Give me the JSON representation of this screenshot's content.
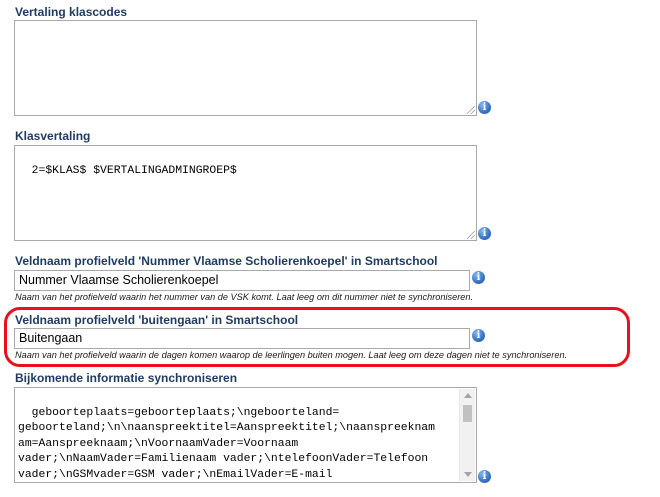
{
  "fields": {
    "vertaling_klascodes": {
      "label": "Vertaling klascodes",
      "value": ""
    },
    "klasvertaling": {
      "label": "Klasvertaling",
      "value": "2=$KLAS$ $VERTALINGADMINGROEP$"
    },
    "vsk_veld": {
      "label": "Veldnaam profielveld 'Nummer Vlaamse Scholierenkoepel' in Smartschool",
      "value": "Nummer Vlaamse Scholierenkoepel",
      "help": "Naam van het profielveld waarin het nummer van de VSK komt. Laat leeg om dit nummer niet te synchroniseren."
    },
    "buitengaan_veld": {
      "label": "Veldnaam profielveld 'buitengaan' in Smartschool",
      "value": "Buitengaan",
      "help": "Naam van het profielveld waarin de dagen komen waarop de leerlingen buiten mogen. Laat leeg om deze dagen niet te synchroniseren."
    },
    "bijkomende_info": {
      "label": "Bijkomende informatie synchroniseren",
      "value": "geboorteplaats=geboorteplaats;\\ngeboorteland=\ngeboorteland;\\n\\naanspreektitel=Aanspreektitel;\\naanspreeknam\nam=Aanspreeknaam;\\nVoornaamVader=Voornaam\nvader;\\nNaamVader=Familienaam vader;\\ntelefoonVader=Telefoon\nvader;\\nGSMvader=GSM vader;\\nEmailVader=E-mail\nvader;\\ntelefoonWerkVader=Telefoon werk"
    }
  },
  "info_icon": {
    "name": "info-icon",
    "glyph": "i"
  },
  "colors": {
    "label": "#1f3a5f",
    "highlight": "#e8101e",
    "info": "#3a78c8"
  }
}
